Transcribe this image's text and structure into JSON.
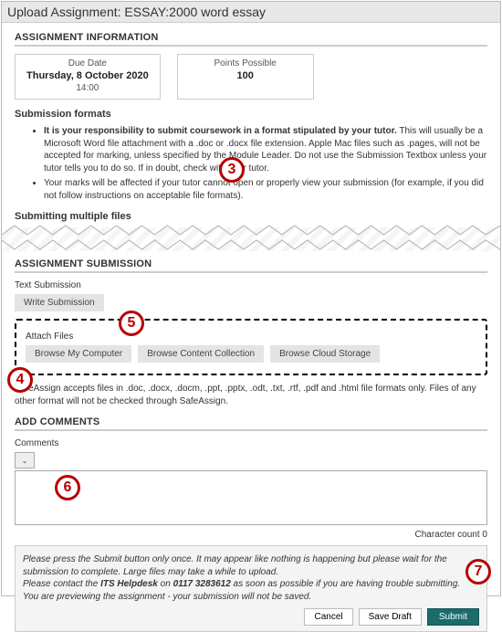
{
  "title": "Upload Assignment: ESSAY:2000 word essay",
  "info": {
    "heading": "ASSIGNMENT INFORMATION",
    "due_label": "Due Date",
    "due_value": "Thursday, 8 October 2020",
    "due_time": "14:00",
    "points_label": "Points Possible",
    "points_value": "100",
    "formats_heading": "Submission formats",
    "bullets": [
      {
        "bold": "It is your responsibility to submit coursework in a format stipulated by your tutor.",
        "rest": " This will usually be a Microsoft Word file attachment with a .doc or .docx file extension. Apple Mac files such as .pages, will not be accepted for marking, unless specified by the Module Leader. Do not use the Submission Textbox unless your tutor tells you to do so. If in doubt, check with your tutor."
      },
      {
        "bold": "",
        "rest": "Your marks will be affected if your tutor cannot open or properly view your submission (for example, if you did not follow instructions on acceptable file formats)."
      }
    ],
    "multi_heading": "Submitting multiple files"
  },
  "submission": {
    "heading": "ASSIGNMENT SUBMISSION",
    "text_sub_label": "Text Submission",
    "write_btn": "Write Submission",
    "attach_label": "Attach Files",
    "browse_computer": "Browse My Computer",
    "browse_content": "Browse Content Collection",
    "browse_cloud": "Browse Cloud Storage",
    "safeassign": "SafeAssign accepts files in .doc, .docx, .docm, .ppt, .pptx, .odt, .txt, .rtf, .pdf and .html file formats only. Files of any other format will not be checked through SafeAssign."
  },
  "comments": {
    "heading": "ADD COMMENTS",
    "label": "Comments",
    "char_count": "Character count 0",
    "value": ""
  },
  "footer": {
    "line1a": "Please press the Submit button only once. It may appear like nothing is happening but please wait for the submission to complete. Large files may take a while to upload.",
    "line2a": "Please contact the ",
    "line2b": "ITS Helpdesk",
    "line2c": " on ",
    "line2d": "0117 3283612",
    "line2e": " as soon as possible if you are having trouble submitting.",
    "line3": "You are previewing the assignment - your submission will not be saved.",
    "cancel": "Cancel",
    "save_draft": "Save Draft",
    "submit": "Submit"
  },
  "callouts": {
    "c3": "3",
    "c4": "4",
    "c5": "5",
    "c6": "6",
    "c7": "7"
  }
}
